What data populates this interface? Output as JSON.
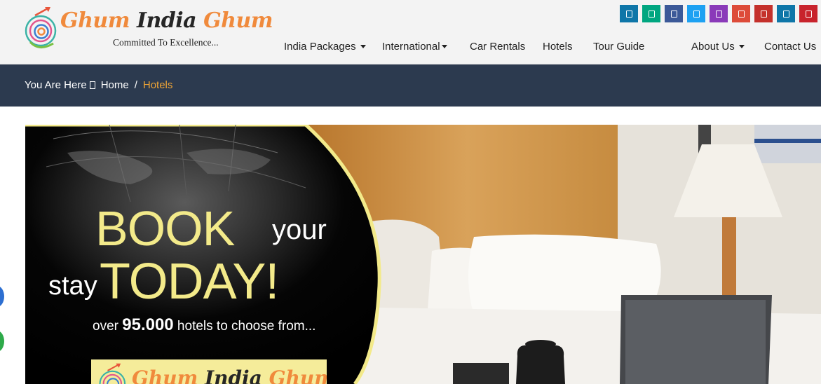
{
  "brand": {
    "name_part1": "Ghum",
    "name_part2": "India",
    "name_part3": "Ghum",
    "tagline": "Committed To Excellence..."
  },
  "social_icons": [
    {
      "name": "linkedin-icon",
      "color": "#0e76a8"
    },
    {
      "name": "tripadvisor-icon",
      "color": "#00a680"
    },
    {
      "name": "facebook-icon",
      "color": "#3b5998"
    },
    {
      "name": "twitter-icon",
      "color": "#1da1f2"
    },
    {
      "name": "instagram-icon",
      "color": "#8a3ab9"
    },
    {
      "name": "google-plus-icon",
      "color": "#dd4b39"
    },
    {
      "name": "youtube-icon",
      "color": "#c4302b"
    },
    {
      "name": "linkedin-icon-2",
      "color": "#0e76a8"
    },
    {
      "name": "pinterest-icon",
      "color": "#c8232c"
    }
  ],
  "nav": {
    "india_packages": "India Packages",
    "international": "International",
    "car_rentals": "Car Rentals",
    "hotels": "Hotels",
    "tour_guide": "Tour Guide",
    "about_us": "About Us",
    "contact_us": "Contact Us"
  },
  "breadcrumb": {
    "prefix": "You Are Here",
    "home": "Home",
    "separator": "/",
    "current": "Hotels"
  },
  "banner": {
    "headline_1": "BOOK",
    "headline_2": "your",
    "headline_3": "stay",
    "headline_4": "TODAY!",
    "sub_1": "over ",
    "sub_count": "95.000",
    "sub_2": " hotels to choose from...",
    "logo_1": "Ghum",
    "logo_2": "India",
    "logo_3": "Ghum"
  },
  "colors": {
    "header_bg": "#f3f3f3",
    "crumbbar_bg": "#2c3a4f",
    "accent_orange": "#f0a535",
    "promo_yellow": "#f3ea8a"
  }
}
